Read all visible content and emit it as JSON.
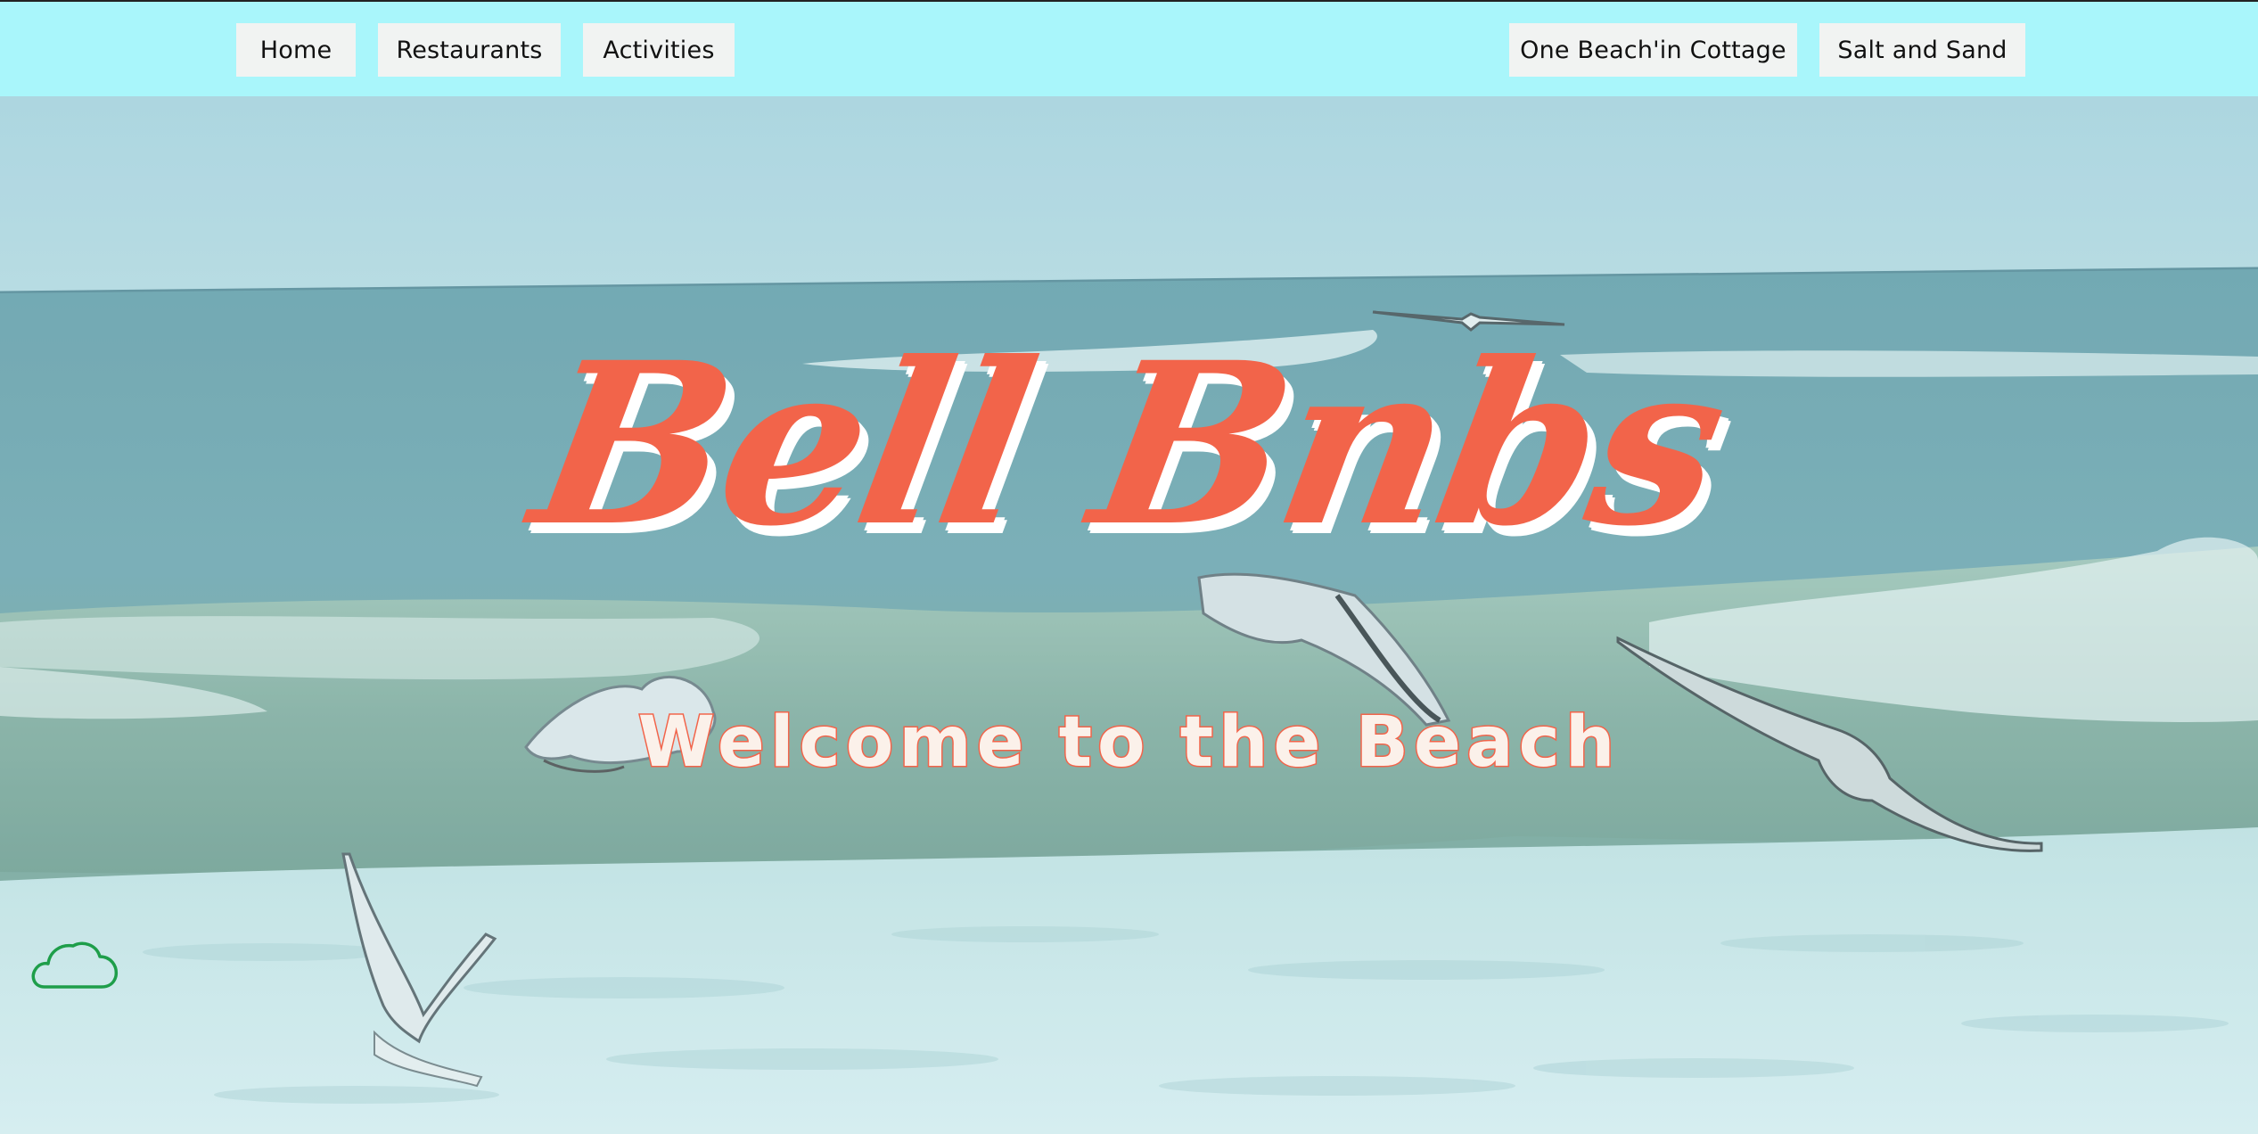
{
  "nav": {
    "left": [
      {
        "label": "Home"
      },
      {
        "label": "Restaurants"
      },
      {
        "label": "Activities"
      }
    ],
    "right": [
      {
        "label": "One Beach'in Cottage"
      },
      {
        "label": "Salt and Sand"
      }
    ]
  },
  "hero": {
    "title": "Bell Bnbs",
    "subtitle": "Welcome to the Beach",
    "background_description_icon": "beach-waves-seagulls-image"
  },
  "widgets": {
    "cloud_icon": "cloud-icon"
  },
  "colors": {
    "nav_background": "#a9f6fb",
    "nav_button": "#f1f3f2",
    "title_coral": "#f2644a",
    "title_shadow": "#ffffff",
    "cloud_green": "#1e9e4a"
  }
}
